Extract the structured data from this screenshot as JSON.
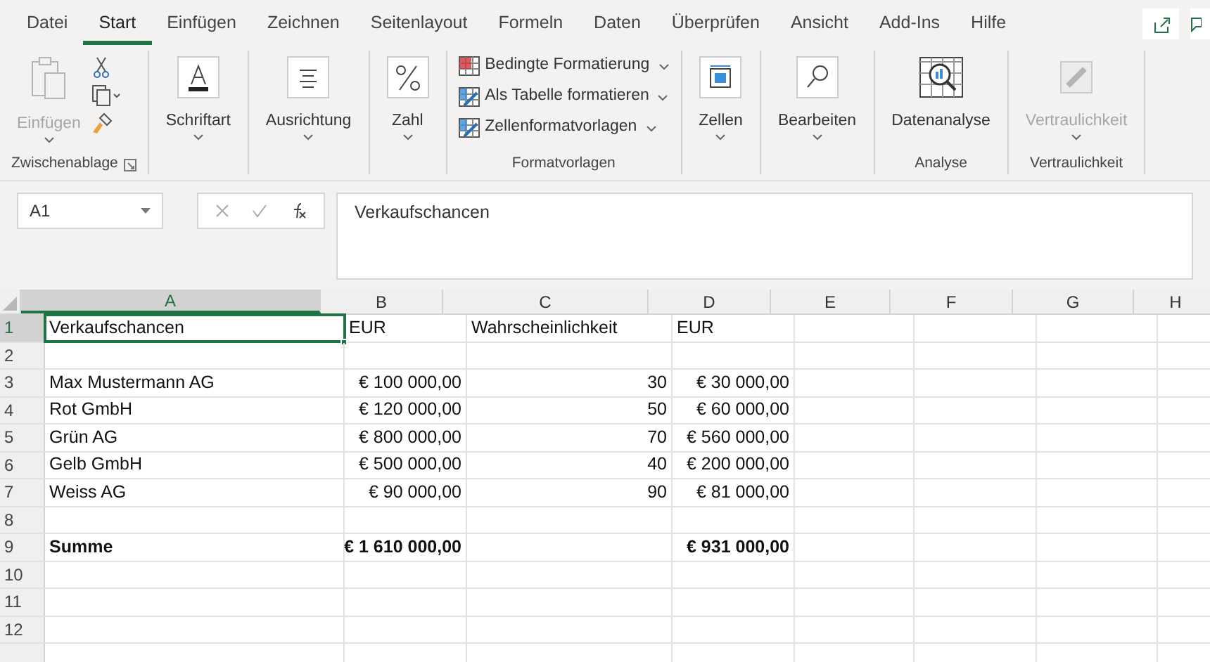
{
  "tabs": [
    {
      "label": "Datei",
      "selected": false
    },
    {
      "label": "Start",
      "selected": true
    },
    {
      "label": "Einfügen",
      "selected": false
    },
    {
      "label": "Zeichnen",
      "selected": false
    },
    {
      "label": "Seitenlayout",
      "selected": false
    },
    {
      "label": "Formeln",
      "selected": false
    },
    {
      "label": "Daten",
      "selected": false
    },
    {
      "label": "Überprüfen",
      "selected": false
    },
    {
      "label": "Ansicht",
      "selected": false
    },
    {
      "label": "Add-Ins",
      "selected": false
    },
    {
      "label": "Hilfe",
      "selected": false
    }
  ],
  "ribbon": {
    "groups": [
      {
        "label": "Zwischenablage",
        "items": [
          {
            "kind": "paste",
            "label": "Einfügen",
            "disabled": true
          },
          {
            "kind": "clip-tools"
          }
        ]
      },
      {
        "items": [
          {
            "kind": "font",
            "label": "Schriftart",
            "disabled": false
          }
        ]
      },
      {
        "items": [
          {
            "kind": "align",
            "label": "Ausrichtung",
            "disabled": false
          }
        ]
      },
      {
        "items": [
          {
            "kind": "number",
            "label": "Zahl",
            "disabled": false
          }
        ]
      },
      {
        "label": "Formatvorlagen",
        "items": [
          {
            "kind": "menu",
            "label": "Bedingte Formatierung"
          },
          {
            "kind": "menu",
            "label": "Als Tabelle formatieren"
          },
          {
            "kind": "menu",
            "label": "Zellenformatvorlagen"
          }
        ]
      },
      {
        "items": [
          {
            "kind": "cells",
            "label": "Zellen",
            "disabled": false
          }
        ]
      },
      {
        "items": [
          {
            "kind": "search",
            "label": "Bearbeiten",
            "disabled": false
          }
        ]
      },
      {
        "label": "Analyse",
        "items": [
          {
            "kind": "analysis",
            "label": "Datenanalyse",
            "disabled": false
          }
        ]
      },
      {
        "label": "Vertraulichkeit",
        "items": [
          {
            "kind": "sensitivity",
            "label": "Vertraulichkeit",
            "disabled": true
          }
        ]
      }
    ]
  },
  "formula_bar": {
    "name_box": "A1",
    "value": "Verkaufschancen"
  },
  "sheet": {
    "columns": [
      {
        "label": "A",
        "selected": true
      },
      {
        "label": "B",
        "selected": false
      },
      {
        "label": "C",
        "selected": false
      },
      {
        "label": "D",
        "selected": false
      },
      {
        "label": "E",
        "selected": false
      },
      {
        "label": "F",
        "selected": false
      },
      {
        "label": "G",
        "selected": false
      },
      {
        "label": "H",
        "selected": false
      }
    ],
    "rows": [
      {
        "label": "1",
        "kind": "header",
        "selected": true,
        "cells": [
          "Verkaufschancen",
          "EUR",
          "Wahrscheinlichkeit",
          "EUR"
        ]
      },
      {
        "label": "2",
        "kind": "data",
        "selected": false
      },
      {
        "label": "3",
        "kind": "data",
        "selected": false,
        "cells": [
          "Max Mustermann AG",
          "€ 100 000,00",
          "30",
          "€ 30 000,00"
        ]
      },
      {
        "label": "4",
        "kind": "data",
        "selected": false,
        "cells": [
          "Rot GmbH",
          "€ 120 000,00",
          "50",
          "€ 60 000,00"
        ]
      },
      {
        "label": "5",
        "kind": "data",
        "selected": false,
        "cells": [
          "Grün AG",
          "€ 800 000,00",
          "70",
          "€ 560 000,00"
        ]
      },
      {
        "label": "6",
        "kind": "data",
        "selected": false,
        "cells": [
          "Gelb GmbH",
          "€ 500 000,00",
          "40",
          "€ 200 000,00"
        ]
      },
      {
        "label": "7",
        "kind": "data",
        "selected": false,
        "cells": [
          "Weiss AG",
          "€ 90 000,00",
          "90",
          "€ 81 000,00"
        ]
      },
      {
        "label": "8",
        "kind": "data",
        "selected": false
      },
      {
        "label": "9",
        "kind": "total",
        "selected": false,
        "cells": [
          "Summe",
          "€ 1 610 000,00",
          null,
          "€ 931 000,00"
        ]
      },
      {
        "label": "10",
        "kind": "data",
        "selected": false
      },
      {
        "label": "11",
        "kind": "data",
        "selected": false
      },
      {
        "label": "12",
        "kind": "data",
        "selected": false
      }
    ]
  }
}
